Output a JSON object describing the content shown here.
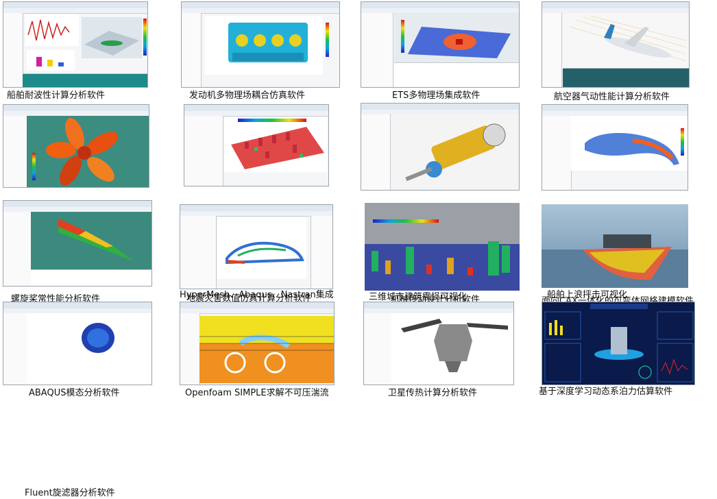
{
  "captions": {
    "c1": "船舶耐波性计算分析软件",
    "c2": "发动机多物理场耦合仿真软件",
    "c3": "ETS多物理场集成软件",
    "c4": "航空器气动性能计算分析软件",
    "c5": "螺旋桨常性能分析软件",
    "c6": "地震灾害数值仿真计算分析软件",
    "c7": "机械传动设计分析软件",
    "c8": "面向CAX一体化的可变体网格建模软件",
    "c9": "Fluent旋滤器分析软件",
    "c10": "HyperMesh、Abaqus、Nastran集成",
    "c11": "三维城市建筑震损可视化",
    "c12": "船舶上浪抨击可视化",
    "c13": "ABAQUS模态分析软件",
    "c14": "Openfoam SIMPLE求解不可压湍流",
    "c15": "卫星传热计算分析软件",
    "c16": "基于深度学习动态系泊力估算软件"
  }
}
